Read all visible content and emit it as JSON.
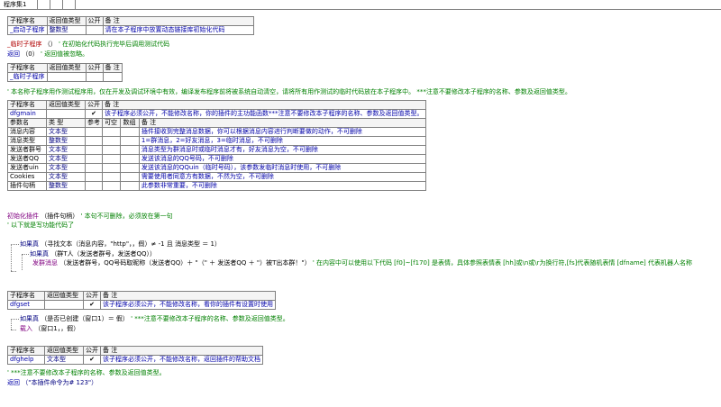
{
  "tab": {
    "title": "程序集1"
  },
  "startup_table": {
    "headers": [
      "子程序名",
      "返回值类型",
      "公开",
      "备 注"
    ],
    "row": {
      "name": "_启动子程序",
      "type": "整数型",
      "public": "",
      "note": "请在本子程序中放置动态链接库初始化代码"
    }
  },
  "init_sub_line": {
    "name": "_临时子程序",
    "paren": "（）",
    "comment": "' 在初始化代码执行完毕后调用测试代码"
  },
  "return_line_1": {
    "keyword": "返回",
    "value": "（0）",
    "comment": "' 返回值被忽略。"
  },
  "temp_table": {
    "headers": [
      "子程序名",
      "返回值类型",
      "公开",
      "备 注"
    ],
    "row": {
      "name": "_临时子程序",
      "type": "",
      "public": "",
      "note": ""
    }
  },
  "temp_comment": "' 本名称子程序用作测试程序用，仅在开发及调试环境中有效，编译发布程序前将被系统自动清空，请将所有用作测试的临时代码放在本子程序中。 ***注意不要修改本子程序的名称、参数及返回值类型。",
  "main_table": {
    "headers": [
      "子程序名",
      "返回值类型",
      "公开",
      "备 注"
    ],
    "row": {
      "name": "dfgmain",
      "type": "",
      "public": "✔",
      "note": "该子程序必须公开，不能修改名称，你的插件的主功能函数***注意不要修改本子程序的名称、参数及返回值类型。"
    },
    "param_headers": [
      "参数名",
      "类 型",
      "参考",
      "可空",
      "数组",
      "备 注"
    ],
    "params": [
      {
        "name": "消息内容",
        "type": "文本型",
        "note": "插件接收到完整消息数据，你可以根据消息内容进行判断要做的动作，不可删除"
      },
      {
        "name": "消息类型",
        "type": "整数型",
        "note": "1=群消息，2=好友消息，3=临时消息，不可删除"
      },
      {
        "name": "发送者群号",
        "type": "文本型",
        "note": "消息类型为群消息时或临时消息才有，好友消息为空，不可删除"
      },
      {
        "name": "发送者QQ",
        "type": "文本型",
        "note": "发送该消息的QQ号码，不可删除"
      },
      {
        "name": "发送者uin",
        "type": "文本型",
        "note": "发送该消息的QQuin（临时号码），该参数发临时消息时使用，不可删除"
      },
      {
        "name": "Cookies",
        "type": "文本型",
        "note": "需要使用者同意方有数据，不然为空，不可删除"
      },
      {
        "name": "插件句柄",
        "type": "整数型",
        "note": "此参数非常重要，不可删除"
      }
    ]
  },
  "init_plugin_line": {
    "name": "初始化插件",
    "arg": "（插件句柄）",
    "comment": "' 本句不可删除，必须放在第一句"
  },
  "below_comment": "' 以下就是写功能代码了",
  "if_line": {
    "keyword": "如果真",
    "text": "（寻找文本（消息内容，\"http\"，，假）≠ -1 且 消息类型 ＝ 1）"
  },
  "kick_line": {
    "keyword": "如果真",
    "text": "（群T人（发送者群号，发送者QQ））"
  },
  "send_line": {
    "name": "发群消息",
    "text": "（发送者群号，QQ号码取昵称（发送者QQ）＋ \"（\" ＋ 发送者QQ ＋ \"）被T出本群！\"）",
    "comment": "' 在内容中可以使用以下代码  [f0]~[f170] 是表情，具体参照表情表 [hh]或\\n或\\r为换行符,[fs]代表随机表情  [dfname] 代表机器人名称"
  },
  "set_table": {
    "headers": [
      "子程序名",
      "返回值类型",
      "公开",
      "备 注"
    ],
    "row": {
      "name": "dfgset",
      "type": "",
      "public": "✔",
      "note": "该子程序必须公开，不能修改名称，看你的插件有设置时使用"
    }
  },
  "set_if_line": {
    "keyword": "如果真",
    "text": "（是否已创建（窗口1）＝ 假）",
    "comment": "' ***注意不要修改本子程序的名称、参数及返回值类型。"
  },
  "load_line": {
    "name": "载入",
    "text": "（窗口1，，假）"
  },
  "help_table": {
    "headers": [
      "子程序名",
      "返回值类型",
      "公开",
      "备 注"
    ],
    "row": {
      "name": "dfghelp",
      "type": "文本型",
      "public": "✔",
      "note": "该子程序必须公开，不能修改名称，返回插件的帮助文档"
    }
  },
  "help_comment": "' ***注意不要修改本子程序的名称、参数及返回值类型。",
  "return_line_2": {
    "keyword": "返回",
    "value": "（\"本插件命令为# 123\"）"
  }
}
